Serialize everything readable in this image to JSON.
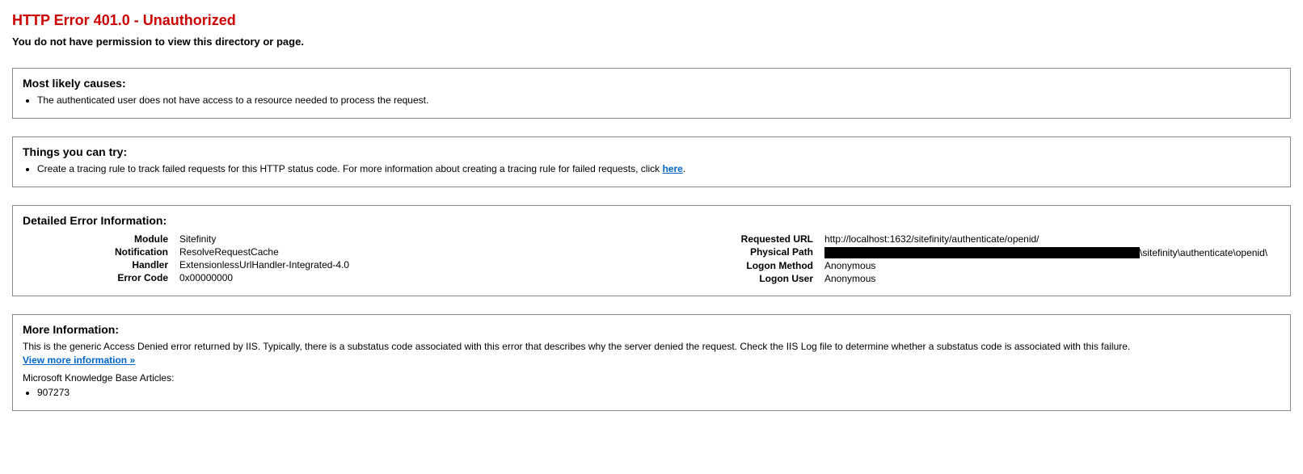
{
  "error": {
    "title": "HTTP Error 401.0 - Unauthorized",
    "subtitle": "You do not have permission to view this directory or page."
  },
  "causes": {
    "heading": "Most likely causes:",
    "items": [
      "The authenticated user does not have access to a resource needed to process the request."
    ]
  },
  "try": {
    "heading": "Things you can try:",
    "item_prefix": "Create a tracing rule to track failed requests for this HTTP status code. For more information about creating a tracing rule for failed requests, click ",
    "link_text": "here",
    "item_suffix": "."
  },
  "details": {
    "heading": "Detailed Error Information:",
    "left": {
      "module_label": "Module",
      "module_value": "Sitefinity",
      "notification_label": "Notification",
      "notification_value": "ResolveRequestCache",
      "handler_label": "Handler",
      "handler_value": "ExtensionlessUrlHandler-Integrated-4.0",
      "errorcode_label": "Error Code",
      "errorcode_value": "0x00000000"
    },
    "right": {
      "requested_url_label": "Requested URL",
      "requested_url_value": "http://localhost:1632/sitefinity/authenticate/openid/",
      "physical_path_label": "Physical Path",
      "physical_path_suffix": "\\sitefinity\\authenticate\\openid\\",
      "logon_method_label": "Logon Method",
      "logon_method_value": "Anonymous",
      "logon_user_label": "Logon User",
      "logon_user_value": "Anonymous"
    }
  },
  "more": {
    "heading": "More Information:",
    "text": "This is the generic Access Denied error returned by IIS. Typically, there is a substatus code associated with this error that describes why the server denied the request. Check the IIS Log file to determine whether a substatus code is associated with this failure.",
    "view_more_link": "View more information »",
    "kb_label": "Microsoft Knowledge Base Articles:",
    "kb_items": [
      "907273"
    ]
  }
}
